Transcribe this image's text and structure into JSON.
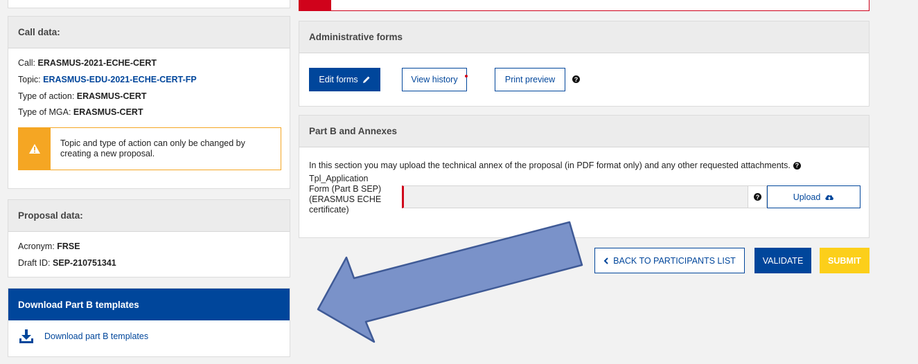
{
  "call_data": {
    "title": "Call data:",
    "call_label": "Call: ",
    "call_value": "ERASMUS-2021-ECHE-CERT",
    "topic_label": "Topic: ",
    "topic_value": "ERASMUS-EDU-2021-ECHE-CERT-FP",
    "action_label": "Type of action: ",
    "action_value": "ERASMUS-CERT",
    "mga_label": "Type of MGA: ",
    "mga_value": "ERASMUS-CERT",
    "warning": "Topic and type of action can only be changed by creating a new proposal."
  },
  "proposal_data": {
    "title": "Proposal data:",
    "acronym_label": "Acronym: ",
    "acronym_value": "FRSE",
    "draft_label": "Draft ID: ",
    "draft_value": "SEP-210751341"
  },
  "download": {
    "title": "Download Part B templates",
    "link": "Download part B templates"
  },
  "admin_forms": {
    "title": "Administrative forms",
    "edit": "Edit forms",
    "history": "View history",
    "preview": "Print preview"
  },
  "part_b": {
    "title": "Part B and Annexes",
    "description": "In this section you may upload the technical annex of the proposal (in PDF format only) and any other requested attachments.",
    "file_label_1": "Tpl_Application",
    "file_label_2": "Form (Part B SEP)",
    "file_label_3": "(ERASMUS ECHE",
    "file_label_4": "certificate)",
    "upload": "Upload"
  },
  "actions": {
    "back": "BACK TO PARTICIPANTS LIST",
    "validate": "VALIDATE",
    "submit": "SUBMIT"
  },
  "colors": {
    "primary": "#00469b",
    "warning": "#f5a623",
    "yellow": "#fccf1a",
    "error": "#d0021b",
    "arrow": "#7a92c9"
  }
}
